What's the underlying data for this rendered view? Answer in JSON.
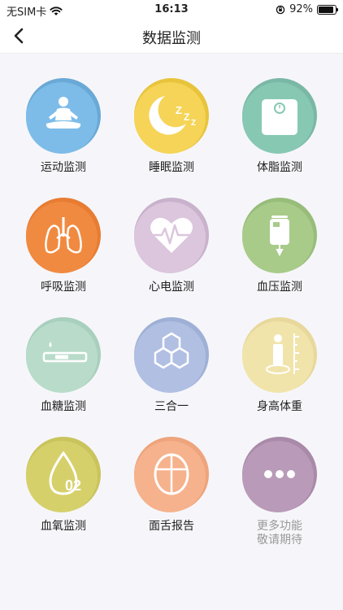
{
  "statusbar": {
    "carrier": "无SIM卡",
    "time": "16:13",
    "battery": "92%"
  },
  "navbar": {
    "title": "数据监测"
  },
  "tiles": [
    {
      "label": "运动监测",
      "ring": "#6aa9d6",
      "fill": "#7dbce9",
      "icon": "meditation-icon"
    },
    {
      "label": "睡眠监测",
      "ring": "#e8c43c",
      "fill": "#f5d457",
      "icon": "moon-sleep-icon"
    },
    {
      "label": "体脂监测",
      "ring": "#7ab8a5",
      "fill": "#87c8b3",
      "icon": "scale-icon"
    },
    {
      "label": "呼吸监测",
      "ring": "#e77c32",
      "fill": "#f08a40",
      "icon": "lungs-icon"
    },
    {
      "label": "心电监测",
      "ring": "#c9b2cc",
      "fill": "#dbc6dd",
      "icon": "heart-ecg-icon"
    },
    {
      "label": "血压监测",
      "ring": "#98bd7b",
      "fill": "#a8cb8a",
      "icon": "iv-bag-icon"
    },
    {
      "label": "血糖监测",
      "ring": "#a9cfbe",
      "fill": "#b8dcc9",
      "icon": "glucose-strip-icon"
    },
    {
      "label": "三合一",
      "ring": "#9fb0d6",
      "fill": "#b0bfe2",
      "icon": "hexagons-icon"
    },
    {
      "label": "身高体重",
      "ring": "#e8d89c",
      "fill": "#f1e4ab",
      "icon": "height-measure-icon"
    },
    {
      "label": "血氧监测",
      "ring": "#c9c45c",
      "fill": "#d6d06b",
      "icon": "o2-drop-icon"
    },
    {
      "label": "面舌报告",
      "ring": "#eea47c",
      "fill": "#f6b28c",
      "icon": "tongue-icon"
    },
    {
      "label": "更多功能\n敬请期待",
      "ring": "#a98aa8",
      "fill": "#b99ab8",
      "icon": "more-dots-icon",
      "muted": true
    }
  ]
}
